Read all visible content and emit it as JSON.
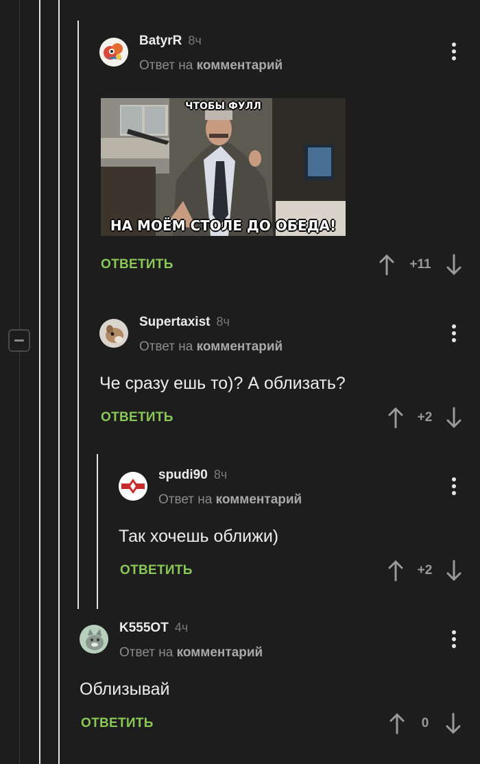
{
  "thread": {
    "collapse_icon": "minus-icon",
    "comments": [
      {
        "author": "BatyrR",
        "time": "8ч",
        "reply_prefix": "Ответ на",
        "reply_link": "комментарий",
        "image": {
          "top_caption": "ЧТОБЫ ФУЛЛ",
          "bottom_caption": "НА МОЁМ СТОЛЕ ДО ОБЕДА!"
        },
        "reply_label": "ОТВЕТИТЬ",
        "score": "+11"
      },
      {
        "author": "Supertaxist",
        "time": "8ч",
        "reply_prefix": "Ответ на",
        "reply_link": "комментарий",
        "text": "Че сразу ешь то)? А облизать?",
        "reply_label": "ОТВЕТИТЬ",
        "score": "+2"
      },
      {
        "author": "spudi90",
        "time": "8ч",
        "reply_prefix": "Ответ на",
        "reply_link": "комментарий",
        "text": "Так хочешь оближи)",
        "reply_label": "ОТВЕТИТЬ",
        "score": "+2"
      },
      {
        "author": "K555OT",
        "time": "4ч",
        "reply_prefix": "Ответ на",
        "reply_link": "комментарий",
        "text": "Облизывай",
        "reply_label": "ОТВЕТИТЬ",
        "score": "0"
      }
    ]
  },
  "colors": {
    "background": "#1d1d1d",
    "reply_button": "#8ac858",
    "thread_line": "#e6e6e6"
  }
}
